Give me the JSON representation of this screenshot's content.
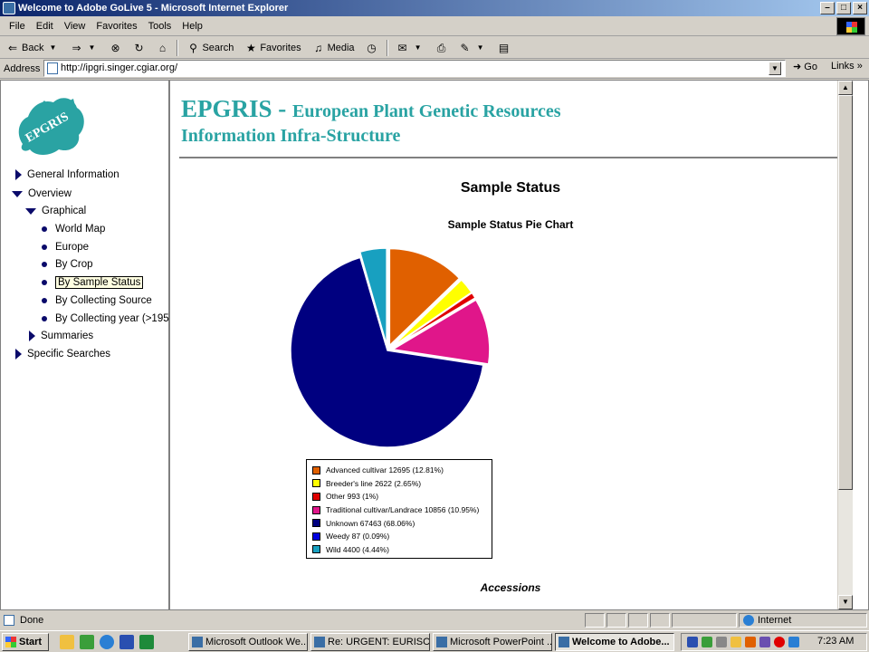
{
  "window": {
    "title": "Welcome to Adobe GoLive 5 - Microsoft Internet Explorer"
  },
  "menu": [
    "File",
    "Edit",
    "View",
    "Favorites",
    "Tools",
    "Help"
  ],
  "toolbar": {
    "back": "Back",
    "search": "Search",
    "favorites": "Favorites",
    "media": "Media"
  },
  "address": {
    "label": "Address",
    "url": "http://ipgri.singer.cgiar.org/",
    "go": "Go",
    "links": "Links"
  },
  "sidebar": {
    "logo_text": "EPGRIS",
    "items": [
      {
        "label": "General Information"
      },
      {
        "label": "Overview"
      },
      {
        "label": "Graphical"
      },
      {
        "label": "World Map"
      },
      {
        "label": "Europe"
      },
      {
        "label": "By Crop"
      },
      {
        "label": "By Sample Status"
      },
      {
        "label": "By Collecting Source"
      },
      {
        "label": "By Collecting year (>195"
      },
      {
        "label": "Summaries"
      },
      {
        "label": "Specific Searches"
      }
    ]
  },
  "header": {
    "epgris": "EPGRIS",
    "dash": " - ",
    "line1": "European Plant Genetic Resources",
    "line2": "Information Infra-Structure"
  },
  "page": {
    "section_title": "Sample Status",
    "footer_label": "Accessions"
  },
  "chart_data": {
    "type": "pie",
    "title": "Sample Status Pie Chart",
    "slices": [
      {
        "label": "Advanced cultivar 12695 (12.81%)",
        "color": "#e06000"
      },
      {
        "label": "Breeder's line 2622 (2.65%)",
        "color": "#ffff00"
      },
      {
        "label": "Other 993 (1%)",
        "color": "#e00000"
      },
      {
        "label": "Traditional cultivar/Landrace 10856 (10.95%)",
        "color": "#e0168a"
      },
      {
        "label": "Unknown 67463 (68.06%)",
        "color": "#000080"
      },
      {
        "label": "Weedy 87 (0.09%)",
        "color": "#0000e0"
      },
      {
        "label": "Wild 4400 (4.44%)",
        "color": "#18a0c0"
      }
    ]
  },
  "status": {
    "text": "Done",
    "zone": "Internet"
  },
  "taskbar": {
    "start": "Start",
    "tasks": [
      {
        "label": "Microsoft Outlook We..."
      },
      {
        "label": "Re: URGENT: EURISC..."
      },
      {
        "label": "Microsoft PowerPoint ..."
      },
      {
        "label": "Welcome to Adobe..."
      }
    ],
    "clock": "7:23 AM"
  }
}
